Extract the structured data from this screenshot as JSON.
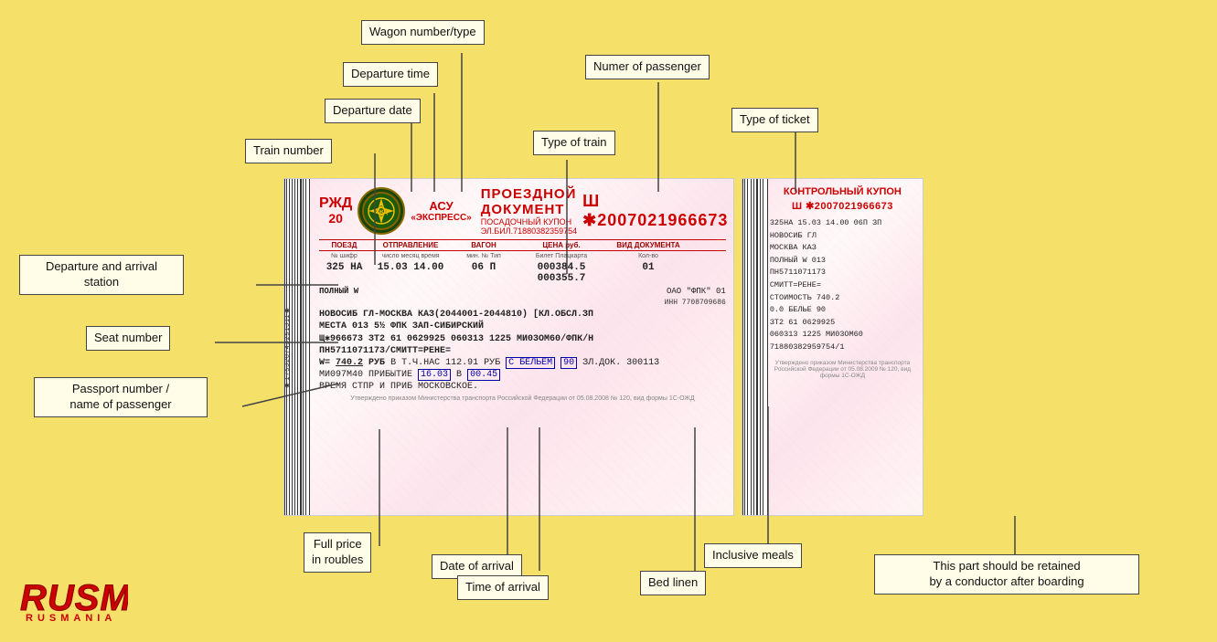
{
  "background_color": "#f5e068",
  "annotations": {
    "wagon_number_type": "Wagon number/type",
    "departure_time": "Departure time",
    "departure_date": "Departure date",
    "train_number": "Train number",
    "numer_of_passenger": "Numer of passenger",
    "type_of_ticket": "Type of ticket",
    "type_of_train": "Type of train",
    "departure_arrival_station": "Departure and arrival\nstation",
    "seat_number": "Seat number",
    "passport_number": "Passport number /\nname of passenger",
    "full_price": "Full price\nin roubles",
    "date_of_arrival": "Date of arrival",
    "time_of_arrival": "Time of arrival",
    "bed_linen": "Bed linen",
    "inclusive_meals": "Inclusive meals",
    "conductor_retain": "This part should be retained\nby a conductor after boarding"
  },
  "ticket": {
    "rzd_label": "РЖД",
    "rzd_number": "20",
    "asy_label": "АСУ",
    "express_label": "«ЭКСПРЕСС»",
    "proeznoy_label": "ПРОЕЗДНОЙ",
    "document_label": "ДОКУМЕНТ",
    "posadochny_label": "ПОСАДОЧНЫЙ КУПОН ЭЛ.БИЛ.71880382359754",
    "ticket_id": "Ш ✱2007021966673",
    "col_headers": [
      "ПОЕЗД",
      "ОТПРАВЛЕНИЕ",
      "ВАГОН",
      "ЦЕНА руб.",
      "ВИД ДОКУМЕНТА"
    ],
    "col_subheaders": [
      "№ шифр",
      "число  месяц  время",
      "мин.  №  Тип",
      "Билет  Плацкарта",
      "Кол-во"
    ],
    "data_row": [
      "325  НА",
      "15.03  14.00",
      "06 П",
      "000384.5  000355.7",
      "01"
    ],
    "doc_type": "ПОЛНЫЙ W",
    "company": "ОАО \"ФПК\"  01",
    "inn": "ИНН 7708709686",
    "station_line": "НОВОСИБ ГЛ-МОСКВА КАЗ(2044001-2044810) [КЛ.ОБСЛ.ЗП",
    "seat_line": "МЕСТА 013 5½ ФПК ЗАП-СИБИРСКИЙ",
    "passenger_line": "Щ✱966673 ЗТ2 61 0629925  060313 1225 МИ03ОМ60/ФПК/Н",
    "passport_line": "ПН5711071173/СМИТТ=РЕНЕ=",
    "price_line": "W= 740.2 РУБ  В Т.Ч.НАС 112.91 РУБ С БЕЛЬЕМ 90 ЗЛ.ДОК. 300113",
    "arrival_line": "МИ097М40 ПРИБЫТИЕ 16.03 В 00.45",
    "time_note": "ВРЕМЯ СТПР И ПРИБ МОСКОВСКОЕ.",
    "footer_note": "Утверждено приказом Министерства транспорта Российской Федерации от 05.08.2008 № 120, вид формы 1С-ОЖД"
  },
  "control_coupon": {
    "title": "КОНТРОЛЬНЫЙ КУПОН",
    "number": "Ш ✱2007021966673",
    "lines": [
      "325НА 15.03 14.00 06П ЗП",
      "НОВОСИБ ГЛ",
      "МОСКВА КАЗ",
      "ПОЛНЫЙ W 013",
      "ПН5711071173",
      "СМИТТ=РЕНЕ=",
      "СТОИМОСТЬ 740.2",
      "0.0  БЕЛЬЕ 90",
      "ЗТ2 61 0629925",
      "060313 1225 МИ03ОМ60",
      "71880382959754/1"
    ],
    "footer": "Утверждено приказом Министерства транспорта Российской Федерации от 05.08.2009 № 120, вид формы 1С-ОЖД"
  },
  "rusmania": {
    "logo_text": "RUSMANIA",
    "sub_text": "RUSMANIA"
  }
}
